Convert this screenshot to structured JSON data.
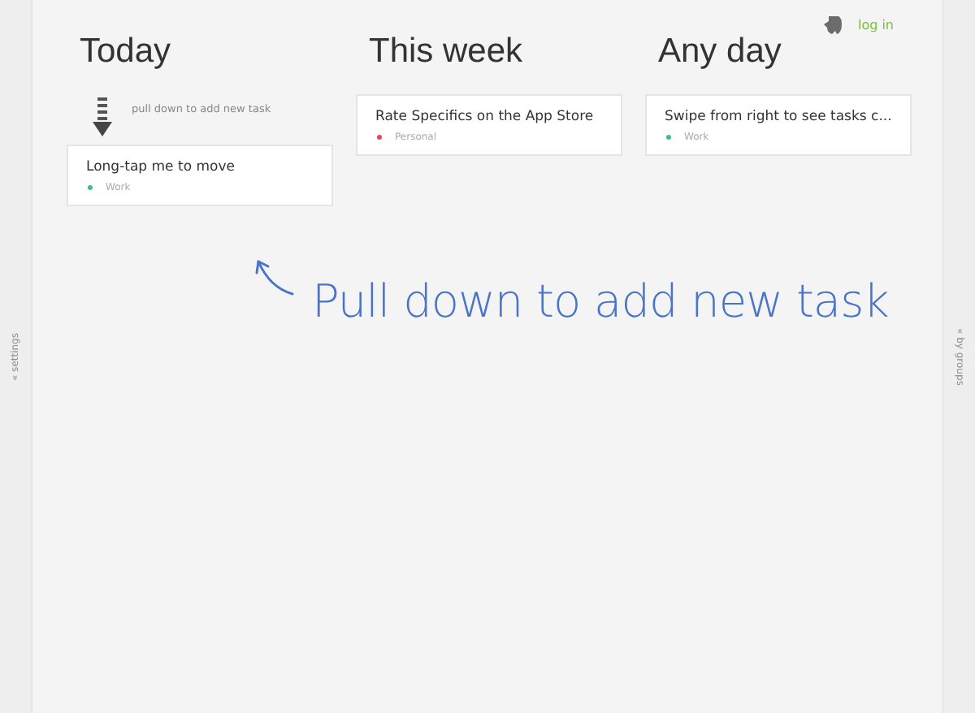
{
  "left_rail": {
    "label": "« settings"
  },
  "right_rail": {
    "label": "« by groups"
  },
  "login": {
    "label": "log in"
  },
  "columns": [
    {
      "title": "This week",
      "tasks": [
        {
          "title": "Rate Specifics on the App Store",
          "tag": "Personal",
          "color": "#e8475a"
        }
      ]
    },
    {
      "title": "Any day",
      "tasks": [
        {
          "title": "Swipe from right to see tasks c...",
          "tag": "Work",
          "color": "#3fbf7f"
        }
      ]
    }
  ],
  "today": {
    "title": "Today",
    "hint": "pull down to add new task",
    "tasks": [
      {
        "title": "Long-tap me to move",
        "tag": "Work",
        "color": "#3fbf7f"
      }
    ]
  },
  "callout": {
    "text": "Pull down to add new task"
  }
}
